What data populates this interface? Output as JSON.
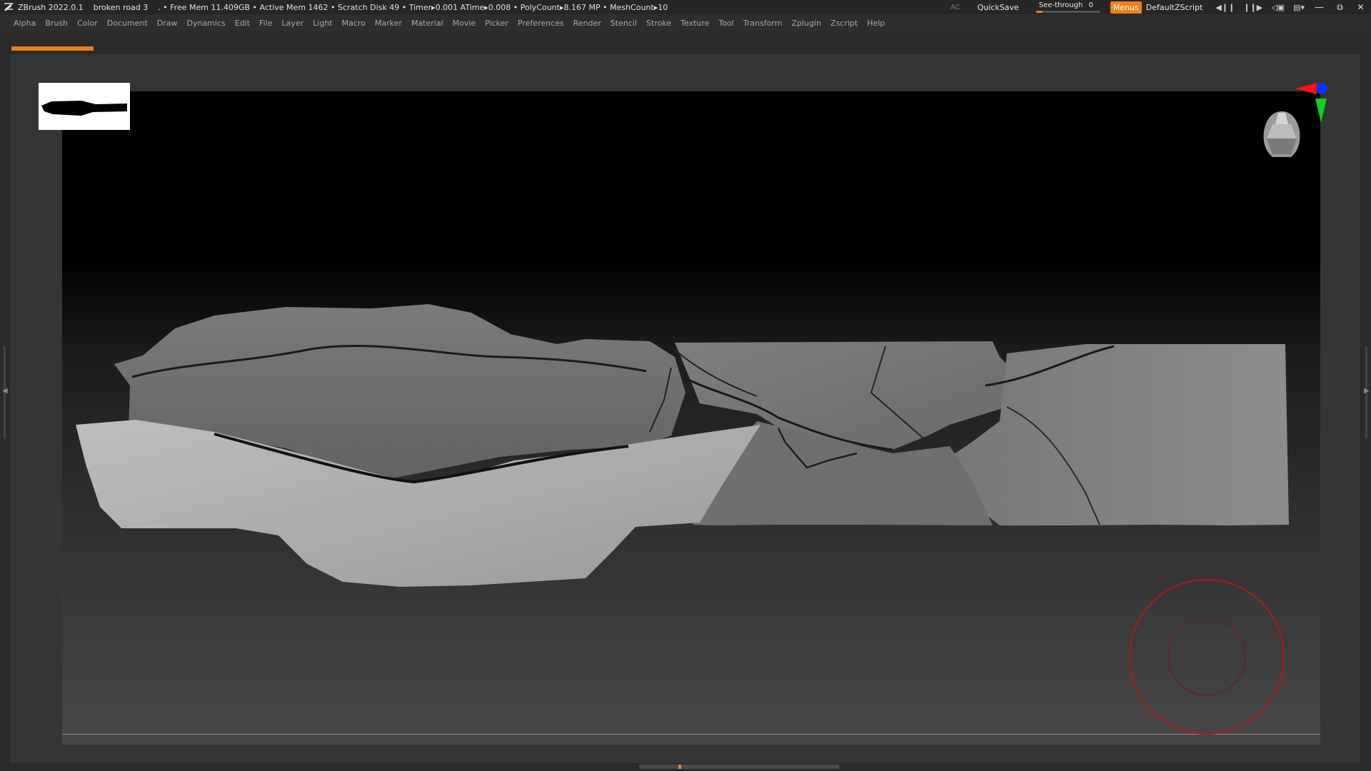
{
  "titlebar": {
    "app": "ZBrush 2022.0.1",
    "document": "broken road 3",
    "stats": ". • Free Mem 11.409GB • Active Mem 1462 • Scratch Disk 49 •  Timer▸0.001 ATime▸0.008 • PolyCount▸8.167 MP  • MeshCount▸10",
    "ac_label": "AC",
    "quicksave_label": "QuickSave",
    "see_through_label": "See-through",
    "see_through_value": "0",
    "see_through_fill": 0.1,
    "menus_label": "Menus",
    "default_zscript_label": "DefaultZScript"
  },
  "menubar": {
    "items": [
      "Alpha",
      "Brush",
      "Color",
      "Document",
      "Draw",
      "Dynamics",
      "Edit",
      "File",
      "Layer",
      "Light",
      "Macro",
      "Marker",
      "Material",
      "Movie",
      "Picker",
      "Preferences",
      "Render",
      "Stencil",
      "Stroke",
      "Texture",
      "Tool",
      "Transform",
      "Zplugin",
      "Zscript",
      "Help"
    ]
  },
  "colors": {
    "accent": "#ef7f1a",
    "brush_ring": "#b01818",
    "gyro_x": "#ff1010",
    "gyro_y": "#10d020",
    "gyro_z": "#1030ff"
  },
  "icons": [
    "zbrush-logo-icon",
    "switch-light-icon",
    "undo-history-icon",
    "floating-palette-icon",
    "interface-layout-icon",
    "minimize-icon",
    "restore-icon",
    "close-icon"
  ]
}
